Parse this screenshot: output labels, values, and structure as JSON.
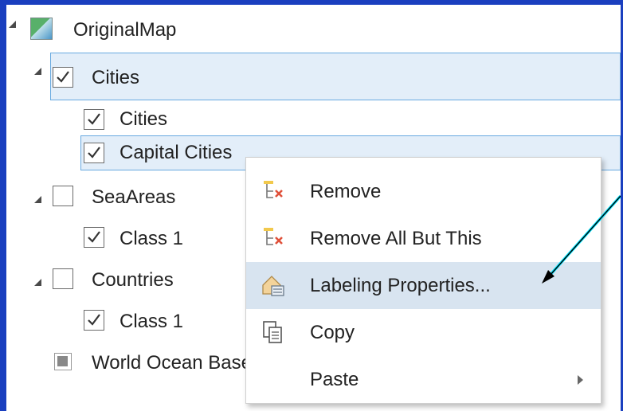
{
  "tree": {
    "map": {
      "label": "OriginalMap"
    },
    "cities_layer": {
      "label": "Cities",
      "checked": true
    },
    "cities_class": {
      "label": "Cities",
      "checked": true
    },
    "capital_class": {
      "label": "Capital Cities",
      "checked": true
    },
    "seaareas_layer": {
      "label": "SeaAreas",
      "checked": false
    },
    "seaareas_class": {
      "label": "Class 1",
      "checked": true
    },
    "countries_layer": {
      "label": "Countries",
      "checked": false
    },
    "countries_class": {
      "label": "Class 1",
      "checked": true
    },
    "ocean_layer": {
      "label": "World Ocean Base"
    }
  },
  "context_menu": {
    "items": [
      {
        "label": "Remove",
        "icon": "remove-layer-icon"
      },
      {
        "label": "Remove All But This",
        "icon": "remove-all-but-this-icon"
      },
      {
        "label": "Labeling Properties...",
        "icon": "labeling-properties-icon",
        "highlighted": true
      },
      {
        "label": "Copy",
        "icon": "copy-icon"
      },
      {
        "label": "Paste",
        "icon": "paste-icon",
        "has_submenu": true
      }
    ]
  },
  "colors": {
    "background": "#1a3fbf",
    "selection_fill": "#e3eef9",
    "selection_border": "#68a9e0",
    "menu_highlight": "#d8e4f0",
    "annotation_arrow": "#00e5ff"
  }
}
